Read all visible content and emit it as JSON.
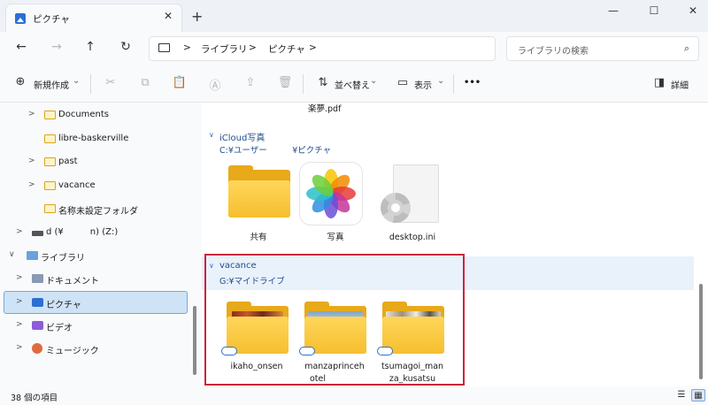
{
  "window": {
    "tab_title": "ピクチャ",
    "tab_close": "✕",
    "new_tab": "+",
    "minimize": "—",
    "maximize": "☐",
    "close": "✕"
  },
  "address": {
    "nav_back": "←",
    "nav_forward": "→",
    "nav_up": "↑",
    "nav_refresh": "↻",
    "crumbs": [
      "ライブラリ",
      "ピクチャ"
    ],
    "separator": ">",
    "search_placeholder": "ライブラリの検索",
    "search_icon": "⌕"
  },
  "commands": {
    "new_label": "新規作成",
    "new_icon": "⊕",
    "sort_label": "並べ替え",
    "view_label": "表示",
    "more": "•••",
    "details_label": "詳細",
    "dropdown": "⌄",
    "icons": {
      "cut": "✂",
      "copy": "⧉",
      "paste": "📋",
      "rename": "Ⓐ",
      "share": "⇪",
      "delete": "🗑",
      "sort": "⇅",
      "view": "▭",
      "details": "◨"
    }
  },
  "sidebar": {
    "items": [
      {
        "label": "Documents",
        "chev": ">"
      },
      {
        "label": "libre-baskerville",
        "chev": ""
      },
      {
        "label": "past",
        "chev": ">"
      },
      {
        "label": "vacance",
        "chev": ">"
      },
      {
        "label": "名称未設定フォルダ",
        "chev": ""
      },
      {
        "label": "d (¥   n) (Z:)",
        "chev": ">"
      },
      {
        "label": "ライブラリ",
        "chev": "∨"
      },
      {
        "label": "ドキュメント",
        "chev": ">"
      },
      {
        "label": "ピクチャ",
        "chev": ">"
      },
      {
        "label": "ビデオ",
        "chev": ">"
      },
      {
        "label": "ミュージック",
        "chev": ">"
      }
    ]
  },
  "main": {
    "partial_file": "楽夢.pdf",
    "groups": [
      {
        "title": "iCloud写真",
        "path": "C:¥ユーザー   ¥ピクチャ",
        "chev": "∨",
        "items": [
          {
            "name": "共有"
          },
          {
            "name": "写真"
          },
          {
            "name": "desktop.ini"
          }
        ]
      },
      {
        "title": "vacance",
        "path": "G:¥マイドライブ",
        "chev": "∨",
        "items": [
          {
            "name_line1": "ikaho_onsen",
            "name_line2": ""
          },
          {
            "name_line1": "manzaprinceh",
            "name_line2": "otel"
          },
          {
            "name_line1": "tsumagoi_man",
            "name_line2": "za_kusatsu"
          }
        ]
      }
    ]
  },
  "status": {
    "count": "38 個の項目",
    "view_details_icon": "☰",
    "view_tiles_icon": "▦"
  },
  "colors": {
    "accent": "#2b6fd3",
    "highlight_border": "#c8253a",
    "folder": "#f6bf2e"
  }
}
